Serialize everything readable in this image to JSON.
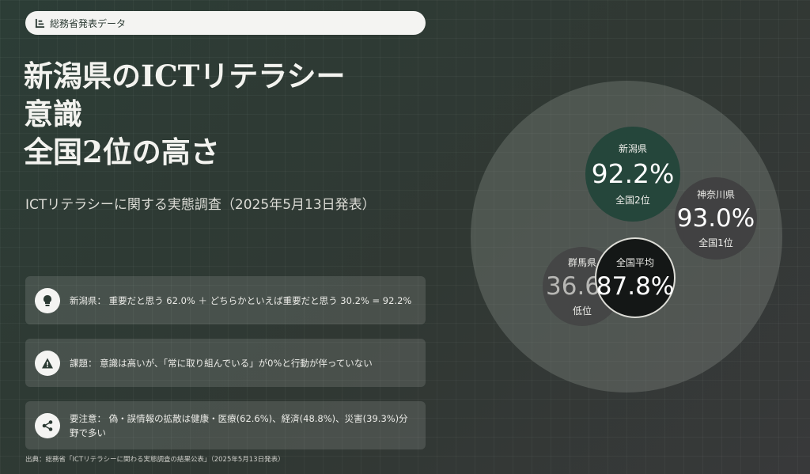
{
  "tag": {
    "text": "総務省発表データ",
    "icon": "bar-chart-icon"
  },
  "title": "新潟県のICTリテラシー\n意識\n全国2位の高さ",
  "subtitle": "ICTリテラシーに関する実態調査（2025年5月13日発表）",
  "cards": [
    {
      "icon": "lightbulb-icon",
      "text": "新潟県： 重要だと思う 62.0% ＋ どちらかといえば重要だと思う 30.2% = 92.2%"
    },
    {
      "icon": "warning-icon",
      "text": "課題： 意識は高いが、「常に取り組んでいる」が0%と行動が伴っていない"
    },
    {
      "icon": "share-icon",
      "text": "要注意： 偽・誤情報の拡散は健康・医療(62.6%)、経済(48.8%)、災害(39.3%)分野で多い"
    }
  ],
  "source": "出典：総務省「ICTリテラシーに関わる実態調査の結果公表」（2025年5月13日発表）",
  "bubbles": {
    "niigata": {
      "label": "新潟県",
      "value": "92.2%",
      "rank": "全国2位",
      "color": "#25463b"
    },
    "kanagawa": {
      "label": "神奈川県",
      "value": "93.0%",
      "rank": "全国1位",
      "color": "#414142"
    },
    "gunma": {
      "label": "群馬県",
      "value": "36.6%",
      "rank": "低位",
      "color": "#454646"
    },
    "average": {
      "label": "全国平均",
      "value": "87.8%",
      "color": "#141716"
    }
  }
}
